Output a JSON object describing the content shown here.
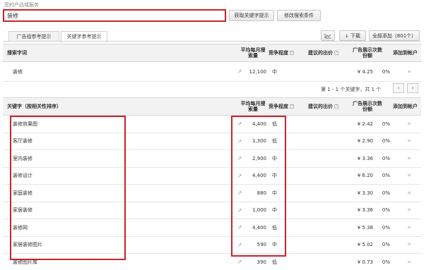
{
  "header": {
    "label": "您的产品或服务",
    "keyword_value": "装修",
    "suggest_button": "获取关键字提示",
    "modify_button": "修改搜索条件"
  },
  "tabs": [
    {
      "label": "广告组参考提示"
    },
    {
      "label": "关键字参考提示"
    }
  ],
  "toolbar": {
    "chart_icon": "chart-icon",
    "download_label": "↓ 下载",
    "all_label": "全部添加（801个）"
  },
  "search_table": {
    "headers": {
      "keyword": "搜索字词",
      "volume": "平均每月搜索量",
      "competition": "竞争程度",
      "bid": "建议的出价",
      "share": "广告展示次数份额",
      "add": "添加到帐户"
    },
    "rows": [
      {
        "keyword": "装修",
        "volume": "12,100",
        "competition": "中",
        "bid": "¥ 4.25",
        "share": "0%",
        "add": "»"
      }
    ]
  },
  "pager": {
    "text": "第 1 - 1 个关键字，共 1 个"
  },
  "keyword_table": {
    "headers": {
      "keyword": "关键字（按相关性排序）",
      "volume": "平均每月搜索量",
      "competition": "竞争程度",
      "bid": "建议的出价",
      "share": "广告展示次数份额",
      "add": "添加到帐户"
    },
    "rows": [
      {
        "keyword": "装修效果图",
        "volume": "4,400",
        "competition": "低",
        "bid": "¥ 2.42",
        "share": "0%",
        "add": "»"
      },
      {
        "keyword": "客厅装修",
        "volume": "1,300",
        "competition": "低",
        "bid": "¥ 2.90",
        "share": "0%",
        "add": "»"
      },
      {
        "keyword": "室内装修",
        "volume": "2,900",
        "competition": "中",
        "bid": "¥ 3.36",
        "share": "0%",
        "add": "»"
      },
      {
        "keyword": "装修设计",
        "volume": "4,400",
        "competition": "中",
        "bid": "¥ 6.20",
        "share": "0%",
        "add": "»"
      },
      {
        "keyword": "家庭装修",
        "volume": "880",
        "competition": "中",
        "bid": "¥ 3.30",
        "share": "0%",
        "add": "»"
      },
      {
        "keyword": "家居装修",
        "volume": "1,000",
        "competition": "中",
        "bid": "¥ 3.36",
        "share": "0%",
        "add": "»"
      },
      {
        "keyword": "装修网",
        "volume": "4,400",
        "competition": "低",
        "bid": "¥ 5.38",
        "share": "0%",
        "add": "»"
      },
      {
        "keyword": "家居装修图片",
        "volume": "590",
        "competition": "中",
        "bid": "¥ 5.02",
        "share": "0%",
        "add": "»"
      },
      {
        "keyword": "装修图片库",
        "volume": "390",
        "competition": "低",
        "bid": "¥ 0.73",
        "share": "0%",
        "add": "»"
      }
    ]
  },
  "colors": {
    "highlight": "#d0202a",
    "header_bg": "#f2f2f2"
  }
}
